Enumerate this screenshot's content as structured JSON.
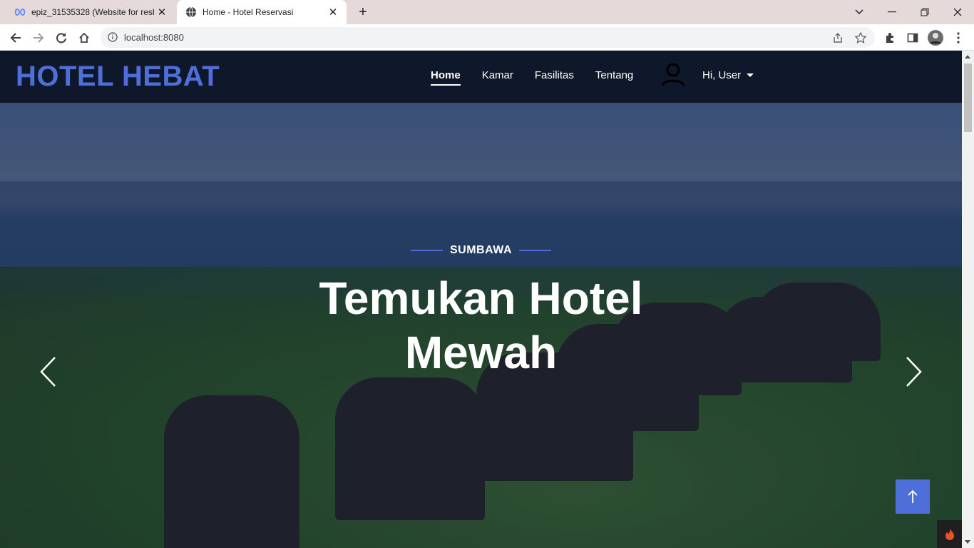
{
  "browser": {
    "tabs": [
      {
        "title": "epiz_31535328 (Website for resh",
        "icon": "infinity-icon"
      },
      {
        "title": "Home - Hotel Reservasi",
        "icon": "globe-icon"
      }
    ],
    "url": "localhost:8080"
  },
  "navbar": {
    "brand": "HOTEL HEBAT",
    "menu": [
      "Home",
      "Kamar",
      "Fasilitas",
      "Tentang"
    ],
    "user_label": "Hi, User"
  },
  "hero": {
    "subtitle": "SUMBAWA",
    "headline_line1": "Temukan Hotel",
    "headline_line2": "Mewah"
  },
  "colors": {
    "accent": "#4f6fd8",
    "navbar_bg": "#0f172b"
  }
}
